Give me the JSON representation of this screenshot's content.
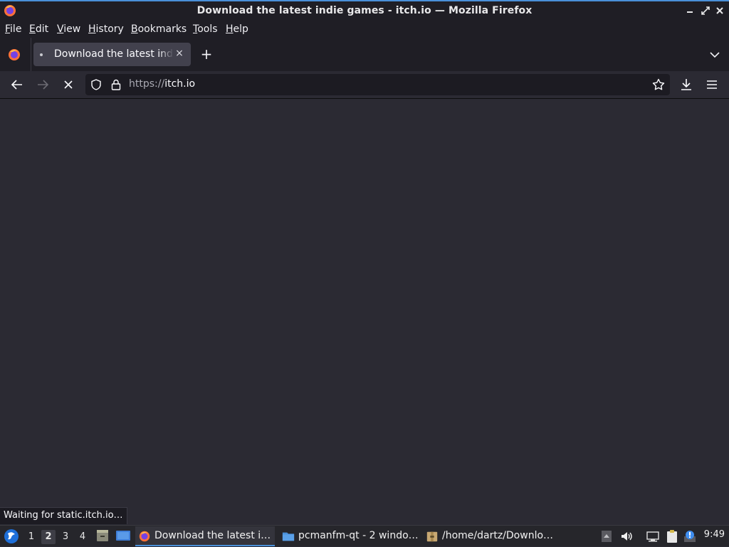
{
  "window": {
    "title": "Download the latest indie games - itch.io — Mozilla Firefox"
  },
  "menubar": {
    "items": [
      {
        "label": "File",
        "accel": "F",
        "rest": "ile"
      },
      {
        "label": "Edit",
        "accel": "E",
        "rest": "dit"
      },
      {
        "label": "View",
        "accel": "V",
        "rest": "iew"
      },
      {
        "label": "History",
        "accel": "H",
        "rest": "istory"
      },
      {
        "label": "Bookmarks",
        "accel": "B",
        "rest": "ookmarks"
      },
      {
        "label": "Tools",
        "accel": "T",
        "rest": "ools"
      },
      {
        "label": "Help",
        "accel": "H",
        "rest": "elp"
      }
    ]
  },
  "tabs": {
    "active": {
      "title": "Download the latest indie games - itch.io",
      "close_label": "×"
    },
    "new_tab_label": "+"
  },
  "navbar": {
    "url_scheme": "https://",
    "url_host": "itch.io"
  },
  "status": {
    "text": "Waiting for static.itch.io…"
  },
  "taskbar": {
    "workspaces": [
      "1",
      "2",
      "3",
      "4"
    ],
    "active_workspace": "2",
    "tasks": [
      {
        "label": "Download the latest i…",
        "icon": "firefox-icon",
        "active": true
      },
      {
        "label": "pcmanfm-qt - 2 windo…",
        "icon": "folder-icon",
        "active": false
      },
      {
        "label": "/home/dartz/Downlo…",
        "icon": "archive-icon",
        "active": false
      }
    ],
    "clock": "9:49"
  },
  "colors": {
    "accent": "#4a90d9",
    "chrome_dark": "#1f1e25",
    "content_bg": "#2b2a33",
    "urlbar_bg": "#1c1b22",
    "tab_active_bg": "#42414d"
  }
}
